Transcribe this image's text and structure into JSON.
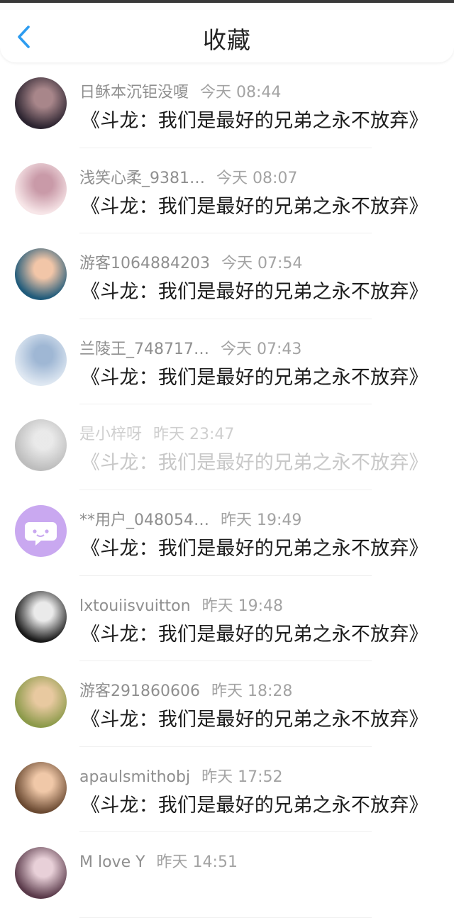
{
  "header": {
    "title": "收藏"
  },
  "items": [
    {
      "user": "日稣本沉钜没嗄",
      "time": "今天 08:44",
      "text": "《斗龙：我们是最好的兄弟之永不放弃》",
      "avatar_colors": [
        "#2c2430",
        "#a8868a"
      ],
      "avatar_icon": "dark-hair-girl-avatar"
    },
    {
      "user": "浅笑心柔_9381…",
      "time": "今天 08:07",
      "text": "《斗龙：我们是最好的兄弟之永不放弃》",
      "avatar_colors": [
        "#f7e6e8",
        "#c99aa8"
      ],
      "avatar_icon": "anime-girl-hat-avatar"
    },
    {
      "user": "游客1064884203",
      "time": "今天 07:54",
      "text": "《斗龙：我们是最好的兄弟之永不放弃》",
      "avatar_colors": [
        "#1f5a7a",
        "#f2c6a8"
      ],
      "avatar_icon": "anime-girl-blue-avatar"
    },
    {
      "user": "兰陵王_748717…",
      "time": "今天 07:43",
      "text": "《斗龙：我们是最好的兄弟之永不放弃》",
      "avatar_colors": [
        "#dfe8f2",
        "#9fb7d4"
      ],
      "avatar_icon": "anime-girl-white-avatar"
    },
    {
      "user": "是小梓呀",
      "time": "昨天 23:47",
      "text": "《斗龙：我们是最好的兄弟之永不放弃》",
      "avatar_colors": [
        "#6d6d6d",
        "#cfcfcf"
      ],
      "avatar_icon": "grey-photo-avatar",
      "faded": true
    },
    {
      "user": "**用户_048054…",
      "time": "昨天 19:49",
      "text": "《斗龙：我们是最好的兄弟之永不放弃》",
      "avatar_colors": [
        "#c9a8f0",
        "#ffffff"
      ],
      "avatar_icon": "chat-bubble-avatar"
    },
    {
      "user": "lxtouiisvuitton",
      "time": "昨天 19:48",
      "text": "《斗龙：我们是最好的兄弟之永不放弃》",
      "avatar_colors": [
        "#1a1a1a",
        "#eaeaea"
      ],
      "avatar_icon": "black-white-photo-avatar"
    },
    {
      "user": "游客291860606",
      "time": "昨天 18:28",
      "text": "《斗龙：我们是最好的兄弟之永不放弃》",
      "avatar_colors": [
        "#8c9a4a",
        "#e8c9a0"
      ],
      "avatar_icon": "reading-photo-avatar"
    },
    {
      "user": "apaulsmithobj",
      "time": "昨天 17:52",
      "text": "《斗龙：我们是最好的兄弟之永不放弃》",
      "avatar_colors": [
        "#6b4a32",
        "#f0c8a8"
      ],
      "avatar_icon": "child-photo-avatar"
    },
    {
      "user": "M love Y",
      "time": "昨天 14:51",
      "text": "",
      "avatar_colors": [
        "#5a3a4a",
        "#e8d0d8"
      ],
      "avatar_icon": "anime-boy-avatar"
    }
  ]
}
